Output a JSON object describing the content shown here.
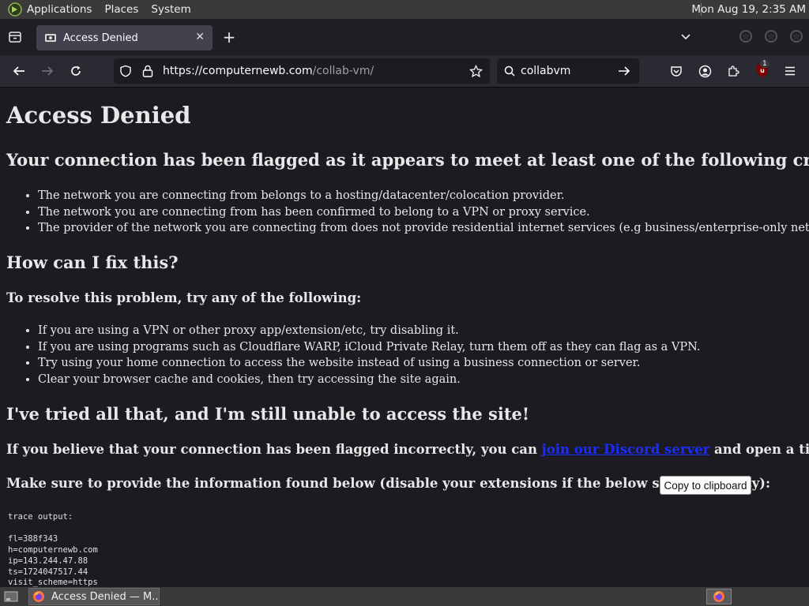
{
  "panel": {
    "menus": [
      "Applications",
      "Places",
      "System"
    ],
    "clock": "Mon Aug 19,  2:35 AM"
  },
  "browser": {
    "tab_title": "Access Denied",
    "url_host": "https://computernewb.com",
    "url_path": "/collab-vm/",
    "search_value": "collabvm",
    "extension_badge": "1"
  },
  "page": {
    "title": "Access Denied",
    "heading1": "Your connection has been flagged as it appears to meet at least one of the following criteria:",
    "criteria": [
      "The network you are connecting from belongs to a hosting/datacenter/colocation provider.",
      "The network you are connecting from has been confirmed to belong to a VPN or proxy service.",
      "The provider of the network you are connecting from does not provide residential internet services (e.g business/enterprise-only networks)."
    ],
    "heading2": "How can I fix this?",
    "subheading": "To resolve this problem, try any of the following:",
    "fixes": [
      "If you are using a VPN or other proxy app/extension/etc, try disabling it.",
      "If you are using programs such as Cloudflare WARP, iCloud Private Relay, turn them off as they can flag as a VPN.",
      "Try using your home connection to access the website instead of using a business connection or server.",
      "Clear your browser cache and cookies, then try accessing the site again."
    ],
    "heading3": "I've tried all that, and I'm still unable to access the site!",
    "flagged_prefix": "If you believe that your connection has been flagged incorrectly, you can",
    "discord_link": "join our Discord server",
    "flagged_suffix": "and open a ticket.",
    "info_text": "Make sure to provide the information found below (disable your extensions if the below space is empty):",
    "copy_button": "Copy to clipboard",
    "trace_lines": [
      "trace output:",
      "",
      "fl=388f343",
      "h=computernewb.com",
      "ip=143.244.47.88",
      "ts=1724047517.44",
      "visit_scheme=https"
    ]
  },
  "taskbar": {
    "task_label": "Access Denied — M..."
  },
  "colors": {
    "page_bg": "#1c1b22",
    "link": "#1a2cff",
    "panel_bg": "#3a3a3a"
  }
}
